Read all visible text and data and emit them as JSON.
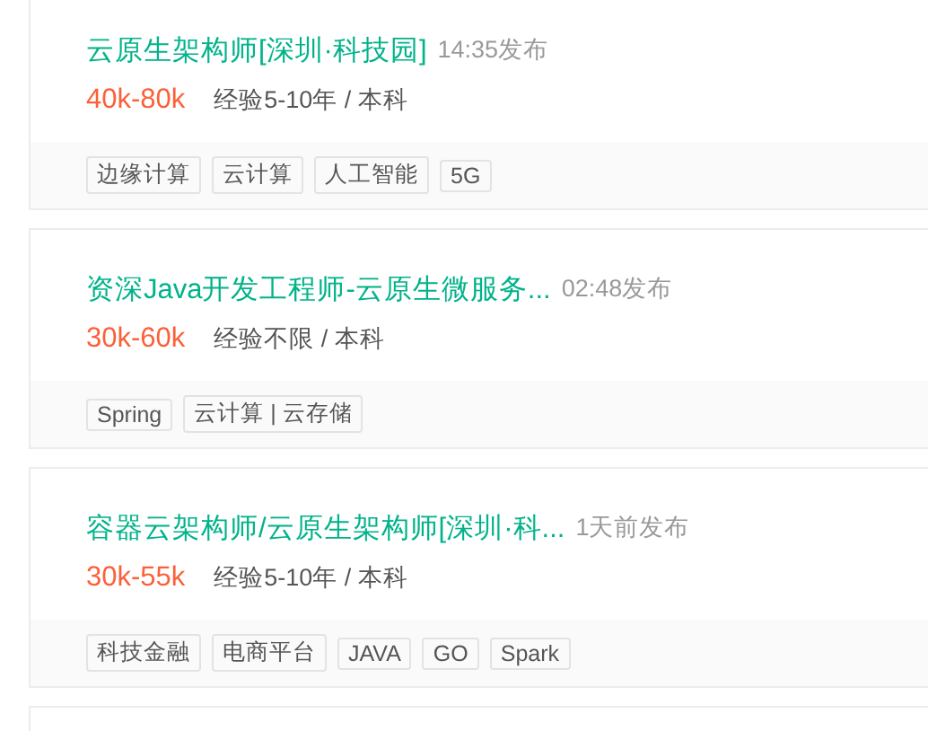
{
  "jobs": [
    {
      "title": "云原生架构师[深圳·科技园]",
      "time": "14:35发布",
      "salary": "40k-80k",
      "requirements": "经验5-10年 / 本科",
      "tags": [
        "边缘计算",
        "云计算",
        "人工智能",
        "5G"
      ]
    },
    {
      "title": "资深Java开发工程师-云原生微服务...",
      "time": "02:48发布",
      "salary": "30k-60k",
      "requirements": "经验不限 / 本科",
      "tags": [
        "Spring",
        "云计算 | 云存储"
      ]
    },
    {
      "title": "容器云架构师/云原生架构师[深圳·科...",
      "time": "1天前发布",
      "salary": "30k-55k",
      "requirements": "经验5-10年 / 本科",
      "tags": [
        "科技金融",
        "电商平台",
        "JAVA",
        "GO",
        "Spark"
      ]
    }
  ]
}
